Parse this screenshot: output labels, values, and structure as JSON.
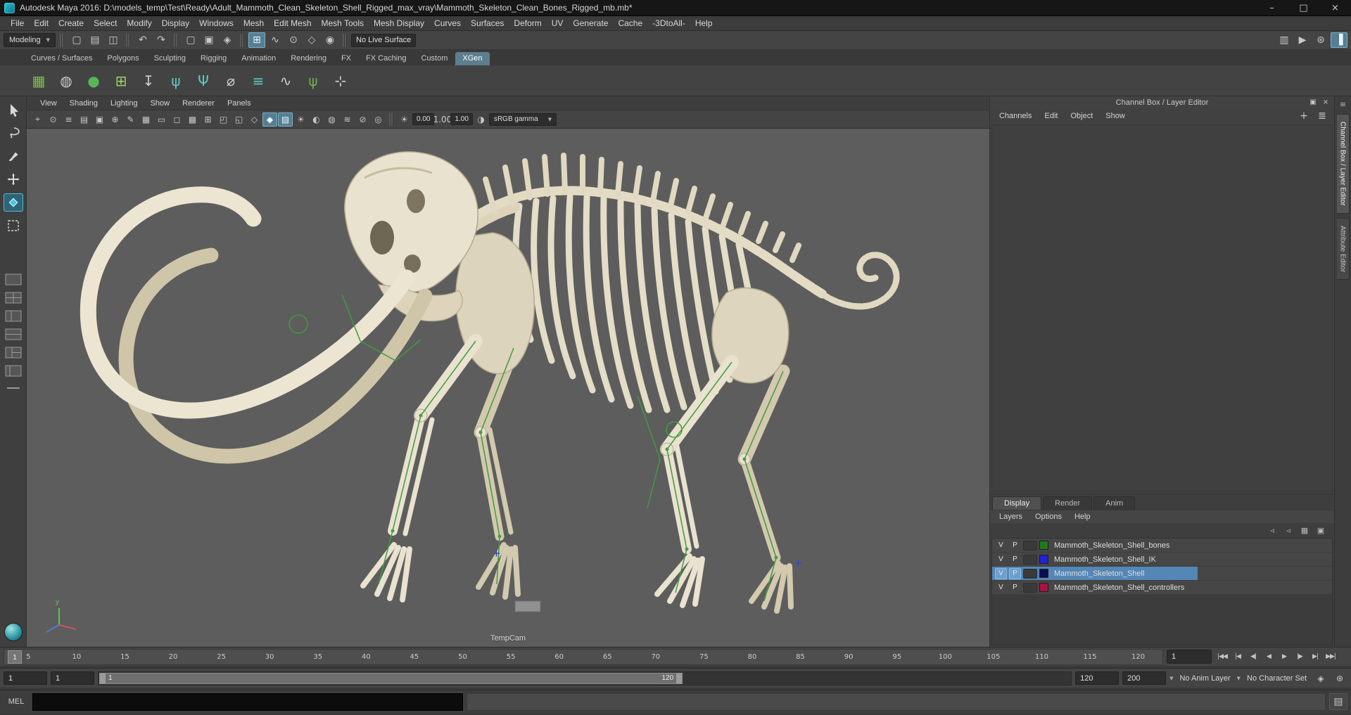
{
  "window": {
    "title": "Autodesk Maya 2016: D:\\models_temp\\Test\\Ready\\Adult_Mammoth_Clean_Skeleton_Shell_Rigged_max_vray\\Mammoth_Skeleton_Clean_Bones_Rigged_mb.mb*",
    "minimize_glyph": "–",
    "maximize_glyph": "□",
    "close_glyph": "×"
  },
  "icons": {
    "caret_down": "▼"
  },
  "menubar": {
    "items": [
      "File",
      "Edit",
      "Create",
      "Select",
      "Modify",
      "Display",
      "Windows",
      "Mesh",
      "Edit Mesh",
      "Mesh Tools",
      "Mesh Display",
      "Curves",
      "Surfaces",
      "Deform",
      "UV",
      "Generate",
      "Cache",
      "-3DtoAll-",
      "Help"
    ]
  },
  "statusline": {
    "mode": "Modeling",
    "live_surface": "No Live Surface",
    "file_icons": [
      {
        "name": "new-scene-icon",
        "glyph": "▢"
      },
      {
        "name": "open-scene-icon",
        "glyph": "▤"
      },
      {
        "name": "save-scene-icon",
        "glyph": "◫"
      }
    ],
    "history_icons": [
      {
        "name": "undo-icon",
        "glyph": "↶"
      },
      {
        "name": "redo-icon",
        "glyph": "↷"
      }
    ],
    "selection_icons": [
      {
        "name": "select-hierarchy-icon",
        "glyph": "▢"
      },
      {
        "name": "select-object-icon",
        "glyph": "▣"
      },
      {
        "name": "select-component-icon",
        "glyph": "◈"
      }
    ],
    "snap_icons": [
      {
        "name": "snap-to-grid-icon",
        "glyph": "⊞",
        "active": true
      },
      {
        "name": "snap-to-curve-icon",
        "glyph": "∿"
      },
      {
        "name": "snap-to-point-icon",
        "glyph": "⊙"
      },
      {
        "name": "snap-to-plane-icon",
        "glyph": "◇"
      },
      {
        "name": "make-live-icon",
        "glyph": "◉"
      }
    ],
    "right_icons": [
      {
        "name": "render-view-icon",
        "glyph": "▥"
      },
      {
        "name": "ipr-render-icon",
        "glyph": "▶"
      },
      {
        "name": "render-settings-icon",
        "glyph": "⊛"
      },
      {
        "name": "toggle-channel-box-icon",
        "glyph": "▐",
        "active": true
      }
    ]
  },
  "shelf": {
    "side_icons": [
      {
        "name": "shelf-tabs-menu-icon",
        "glyph": "≡"
      },
      {
        "name": "shelf-options-icon",
        "glyph": "⊛"
      }
    ],
    "tabs": [
      {
        "label": "Curves / Surfaces"
      },
      {
        "label": "Polygons"
      },
      {
        "label": "Sculpting"
      },
      {
        "label": "Rigging"
      },
      {
        "label": "Animation"
      },
      {
        "label": "Rendering"
      },
      {
        "label": "FX"
      },
      {
        "label": "FX Caching"
      },
      {
        "label": "Custom"
      },
      {
        "label": "XGen",
        "active": true
      }
    ],
    "icons": [
      {
        "name": "xgen-description-editor-icon",
        "glyph": "▦",
        "color": "#7fbf4d"
      },
      {
        "name": "xgen-create-description-icon",
        "glyph": "◍",
        "color": "#cfcfcf"
      },
      {
        "name": "xgen-sphere-preview-icon",
        "glyph": "●",
        "color": "#58b558"
      },
      {
        "name": "xgen-add-collection-icon",
        "glyph": "⊞",
        "color": "#9fd06a"
      },
      {
        "name": "xgen-export-selection-icon",
        "glyph": "↧",
        "color": "#cfcfcf"
      },
      {
        "name": "xgen-guide-tool-icon",
        "glyph": "ψ",
        "color": "#5fc8c0"
      },
      {
        "name": "xgen-groom-tool-icon",
        "glyph": "Ψ",
        "color": "#5fc8c0"
      },
      {
        "name": "xgen-lock-guides-icon",
        "glyph": "⌀",
        "color": "#cfcfcf"
      },
      {
        "name": "xgen-comb-tool-icon",
        "glyph": "≡",
        "color": "#5fc8c0"
      },
      {
        "name": "xgen-curve-utilities-icon",
        "glyph": "∿",
        "color": "#cfcfcf"
      },
      {
        "name": "xgen-grass-preset-icon",
        "glyph": "ψ",
        "color": "#6fae4f"
      },
      {
        "name": "xgen-placement-tool-icon",
        "glyph": "⊹",
        "color": "#cfcfcf"
      }
    ]
  },
  "viewport": {
    "menus": [
      "View",
      "Shading",
      "Lighting",
      "Show",
      "Renderer",
      "Panels"
    ],
    "toolbar_icons": [
      {
        "name": "select-camera-icon",
        "glyph": "⌖"
      },
      {
        "name": "lock-camera-icon",
        "glyph": "⊙"
      },
      {
        "name": "camera-attributes-icon",
        "glyph": "≡"
      },
      {
        "name": "bookmarks-icon",
        "glyph": "▤"
      },
      {
        "name": "image-plane-icon",
        "glyph": "▣"
      },
      {
        "name": "two-d-pan-zoom-icon",
        "glyph": "⊕"
      },
      {
        "name": "grease-pencil-icon",
        "glyph": "✎"
      },
      {
        "name": "grid-toggle-icon",
        "glyph": "▦"
      },
      {
        "name": "film-gate-icon",
        "glyph": "▭"
      },
      {
        "name": "resolution-gate-icon",
        "glyph": "◻"
      },
      {
        "name": "gate-mask-icon",
        "glyph": "▩"
      },
      {
        "name": "field-chart-icon",
        "glyph": "⊞"
      },
      {
        "name": "safe-action-icon",
        "glyph": "◰"
      },
      {
        "name": "safe-title-icon",
        "glyph": "◱"
      },
      {
        "name": "wireframe-mode-icon",
        "glyph": "◇"
      },
      {
        "name": "shaded-mode-icon",
        "glyph": "◆",
        "active": true
      },
      {
        "name": "textured-mode-icon",
        "glyph": "▨",
        "active": true
      },
      {
        "name": "use-all-lights-icon",
        "glyph": "☀"
      },
      {
        "name": "shadows-icon",
        "glyph": "◐"
      },
      {
        "name": "screen-space-ao-icon",
        "glyph": "◍"
      },
      {
        "name": "motion-blur-icon",
        "glyph": "≋"
      },
      {
        "name": "xray-icon",
        "glyph": "⊘"
      },
      {
        "name": "isolate-select-icon",
        "glyph": "◎"
      }
    ],
    "exposure_icon": "☀",
    "exposure": "0.00",
    "gamma_icon": "γ",
    "gamma": "1.00",
    "cm_icon": "◑",
    "color_mode": "sRGB gamma",
    "camera_label": "TempCam",
    "axis_label": "y"
  },
  "channel_box": {
    "title": "Channel Box / Layer Editor",
    "header_icons": [
      {
        "name": "undock-panel-icon",
        "glyph": "▣"
      },
      {
        "name": "close-panel-icon",
        "glyph": "×"
      }
    ],
    "menus": [
      "Channels",
      "Edit",
      "Object",
      "Show"
    ],
    "corner_icons": [
      {
        "name": "show-manipulators-icon",
        "glyph": "+"
      },
      {
        "name": "channel-stats-icon",
        "glyph": "≣"
      }
    ],
    "layer_editor": {
      "tabs": [
        {
          "label": "Display",
          "active": true
        },
        {
          "label": "Render"
        },
        {
          "label": "Anim"
        }
      ],
      "menus": [
        "Layers",
        "Options",
        "Help"
      ],
      "toolbar_icons": [
        {
          "name": "layer-visibility-mode-icon",
          "glyph": "◃"
        },
        {
          "name": "layer-playback-mode-icon",
          "glyph": "◃"
        },
        {
          "name": "create-empty-layer-icon",
          "glyph": "▦"
        },
        {
          "name": "create-layer-from-selected-icon",
          "glyph": "▣"
        }
      ],
      "layers": [
        {
          "v": "V",
          "p": "P",
          "color": "#1f7a1f",
          "name": "Mammoth_Skeleton_Shell_bones",
          "selected": false
        },
        {
          "v": "V",
          "p": "P",
          "color": "#2020dd",
          "name": "Mammoth_Skeleton_Shell_IK",
          "selected": false
        },
        {
          "v": "V",
          "p": "P",
          "color": "#0d0d52",
          "name": "Mammoth_Skeleton_Shell",
          "selected": true
        },
        {
          "v": "V",
          "p": "P",
          "color": "#aa1144",
          "name": "Mammoth_Skeleton_Shell_controllers",
          "selected": false
        }
      ]
    }
  },
  "right_strip": {
    "menu_icon": "≡",
    "tabs": [
      {
        "label": "Channel Box / Layer Editor",
        "active": true
      },
      {
        "label": "Attribute Editor"
      }
    ]
  },
  "timeline": {
    "ticks": [
      "5",
      "10",
      "15",
      "20",
      "25",
      "30",
      "35",
      "40",
      "45",
      "50",
      "55",
      "60",
      "65",
      "70",
      "75",
      "80",
      "85",
      "90",
      "95",
      "100",
      "105",
      "110",
      "115",
      "120"
    ],
    "marker_label": "1",
    "current_frame": "1",
    "playback_buttons": [
      {
        "name": "go-to-start-button",
        "glyph": "|◀◀"
      },
      {
        "name": "step-back-frame-button",
        "glyph": "|◀"
      },
      {
        "name": "step-back-key-button",
        "glyph": "◀|"
      },
      {
        "name": "play-backward-button",
        "glyph": "◀"
      },
      {
        "name": "play-forward-button",
        "glyph": "▶"
      },
      {
        "name": "step-forward-key-button",
        "glyph": "|▶"
      },
      {
        "name": "step-forward-frame-button",
        "glyph": "▶|"
      },
      {
        "name": "go-to-end-button",
        "glyph": "▶▶|"
      }
    ]
  },
  "range_slider": {
    "animation_start": "1",
    "playback_start": "1",
    "bar_start_label": "1",
    "bar_end_label": "120",
    "playback_end": "120",
    "animation_end": "200",
    "anim_layer": "No Anim Layer",
    "character_set": "No Character Set",
    "icons": [
      {
        "name": "auto-keyframe-button",
        "glyph": "◈"
      },
      {
        "name": "animation-preferences-button",
        "glyph": "⊛"
      }
    ]
  },
  "command_line": {
    "label": "MEL",
    "script_editor_icon": "▤"
  }
}
